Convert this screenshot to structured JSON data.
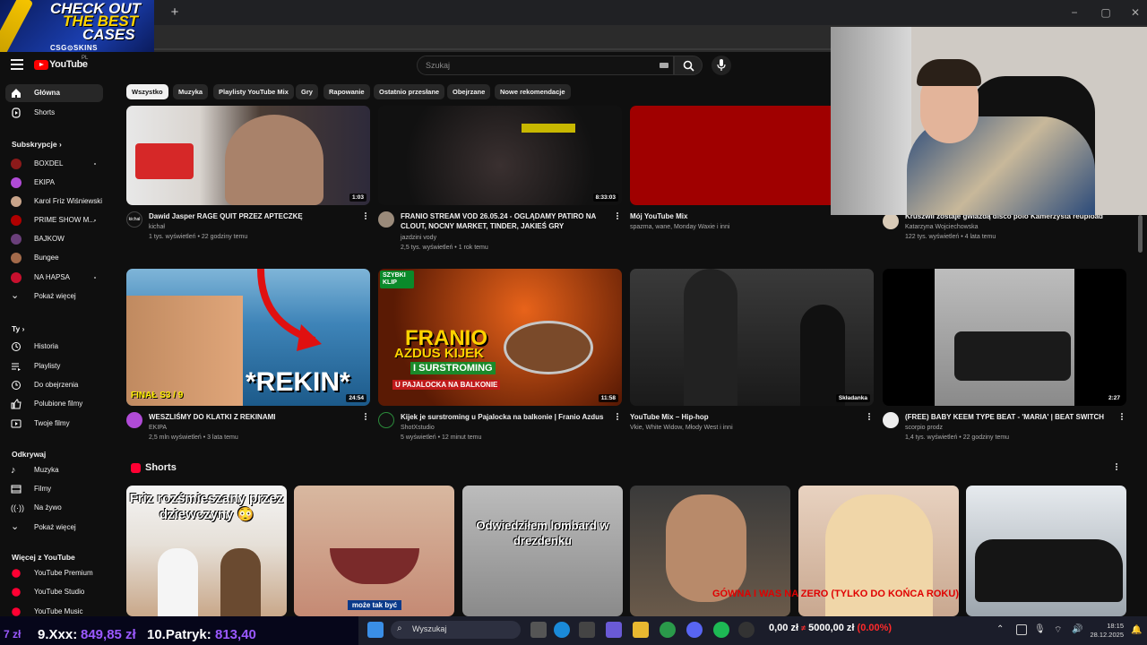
{
  "ad": {
    "line1": "CHECK OUT",
    "line2": "THE BEST",
    "line3": "CASES",
    "brand": "CSG⊙SKINS"
  },
  "header": {
    "logo": "YouTube",
    "region": "PL",
    "search_placeholder": "Szukaj"
  },
  "sidebar": {
    "main": [
      {
        "label": "Główna",
        "icon": "home-icon",
        "active": true
      },
      {
        "label": "Shorts",
        "icon": "shorts-icon"
      }
    ],
    "subs_heading": "Subskrypcje",
    "subs": [
      "BOXDEL",
      "EKIPA",
      "Karol Friz Wiśniewski",
      "PRIME SHOW M...",
      "BAJKOW",
      "Bungee",
      "NA HAPSA"
    ],
    "subs_more": "Pokaż więcej",
    "you_heading": "Ty",
    "you": [
      "Historia",
      "Playlisty",
      "Do obejrzenia",
      "Polubione filmy",
      "Twoje filmy"
    ],
    "explore_heading": "Odkrywaj",
    "explore": [
      "Muzyka",
      "Filmy",
      "Na żywo",
      "Pokaż więcej"
    ],
    "more_heading": "Więcej z YouTube",
    "more": [
      "YouTube Premium",
      "YouTube Studio",
      "YouTube Music"
    ]
  },
  "chips": [
    "Wszystko",
    "Muzyka",
    "Playlisty YouTube Mix",
    "Gry",
    "Rapowanie",
    "Ostatnio przesłane",
    "Obejrzane",
    "Nowe rekomendacje"
  ],
  "videos": [
    {
      "title": "Dawid Jasper RAGE QUIT PRZEZ APTECZKĘ",
      "channel": "kichał",
      "meta": "1 tys. wyświetleń • 22 godziny temu",
      "duration": "1:03",
      "avatar_text": "kichał"
    },
    {
      "title": "FRANIO STREAM VOD 26.05.24 - OGLĄDAMY PATIRO NA CLOUT, NOCNY MARKET, TINDER, JAKIEŚ GRY",
      "channel": "jazdzini vody",
      "meta": "2,5 tys. wyświetleń • 1 rok temu",
      "duration": "8:33:03"
    },
    {
      "title": "Mój YouTube Mix",
      "channel": "spazma, wane, Monday Waxie i inni",
      "meta": ""
    },
    {
      "title": "Kruszwil zostaje gwiazdą disco polo Kamerzysta reupload",
      "channel": "Katarzyna Wojciechowska",
      "meta": "122 tys. wyświetleń • 4 lata temu"
    },
    {
      "title": "WESZLIŚMY DO KLATKI Z REKINAMI",
      "channel": "EKIPA",
      "meta": "2,5 mln wyświetleń • 3 lata temu",
      "duration": "24:54",
      "overlay_left": "FINAŁ S3 / 9",
      "overlay_big": "*REKIN*"
    },
    {
      "title": "Kijek je surstroming u Pajalocka na balkonie | Franio Azdus",
      "channel": "ShotXstudio",
      "meta": "5 wyświetleń • 12 minut temu",
      "duration": "11:58",
      "badge": "SZYBKI KLIP",
      "o1": "FRANIO",
      "o2": "AZDUS KIJEK",
      "o3": "I SURSTROMING",
      "o4": "U PAJALOCKA NA BALKONIE"
    },
    {
      "title": "YouTube Mix – Hip-hop",
      "channel": "Vkie, White Widow, Młody West i inni",
      "meta": "",
      "duration": "Składanka"
    },
    {
      "title": "(FREE) BABY KEEM TYPE BEAT - 'MARIA' | BEAT SWITCH",
      "channel": "scorpio prodz",
      "meta": "1,4 tys. wyświetleń • 22 godziny temu",
      "duration": "2:27"
    }
  ],
  "shorts": {
    "heading": "Shorts",
    "captions": [
      "Friz rozśmieszany przez dziewczyny 😳",
      "może tak być",
      "Odwiedziłem lombard w drezdenku",
      "",
      "",
      ""
    ]
  },
  "overlay": {
    "text": "GÓWNA I WAS NA ZERO (TYLKO DO KOŃCA ROKU)"
  },
  "stream": {
    "left": "7 zł",
    "rank9": "9.Xxx:",
    "val9": "849,85 zł",
    "rank10": "10.Patryk:",
    "val10": "813,40",
    "balance": "0,00 zł",
    "target": "5000,00 zł",
    "pct": "(0.00%)"
  },
  "taskbar": {
    "search": "Wyszukaj",
    "time": "18:15",
    "date": "28.12.2025"
  }
}
